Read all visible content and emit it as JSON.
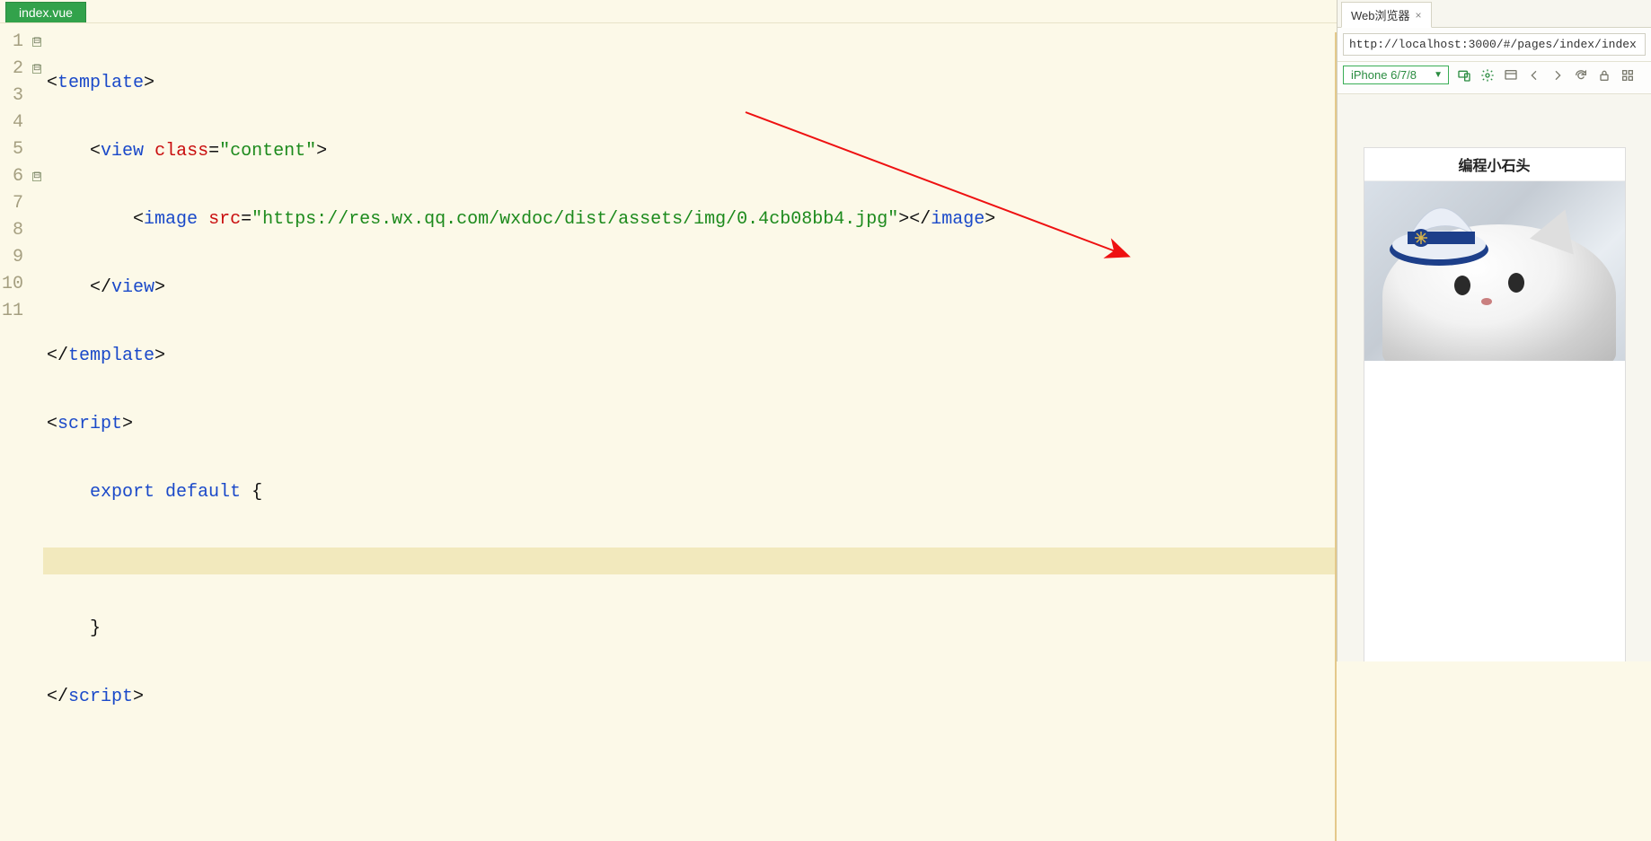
{
  "editor": {
    "tab": {
      "filename": "index.vue"
    },
    "gutter": [
      "1",
      "2",
      "3",
      "4",
      "5",
      "6",
      "7",
      "8",
      "9",
      "10",
      "11"
    ],
    "fold_markers": {
      "1": "⊟",
      "2": "⊟",
      "6": "⊟"
    },
    "highlighted_line": 8,
    "code": {
      "l1": {
        "open": "<",
        "tag": "template",
        "close": ">"
      },
      "l2": {
        "indent": "    ",
        "open": "<",
        "tag": "view",
        "sp": " ",
        "attr": "class",
        "eq": "=",
        "val": "\"content\"",
        "close": ">"
      },
      "l3": {
        "indent": "        ",
        "open": "<",
        "tag": "image",
        "sp": " ",
        "attr": "src",
        "eq": "=",
        "val": "\"https://res.wx.qq.com/wxdoc/dist/assets/img/0.4cb08bb4.jpg\"",
        "close": ">",
        "open2": "</",
        "tag2": "image",
        "close2": ">"
      },
      "l4": {
        "indent": "    ",
        "open": "</",
        "tag": "view",
        "close": ">"
      },
      "l5": {
        "open": "</",
        "tag": "template",
        "close": ">"
      },
      "l6": {
        "open": "<",
        "tag": "script",
        "close": ">"
      },
      "l7": {
        "indent": "    ",
        "kw1": "export",
        "sp1": " ",
        "kw2": "default",
        "sp2": " ",
        "brace": "{"
      },
      "l8": {
        "indent": ""
      },
      "l9": {
        "indent": "    ",
        "brace": "}"
      },
      "l10": {
        "open": "</",
        "tag": "script",
        "close": ">"
      },
      "l11": {
        "indent": ""
      }
    }
  },
  "browser": {
    "panel_tab": "Web浏览器",
    "url": "http://localhost:3000/#/pages/index/index",
    "device": "iPhone 6/7/8",
    "icons": {
      "responsive": "responsive-icon",
      "settings": "gear-icon",
      "devtools": "devtools-icon",
      "back": "back-icon",
      "forward": "forward-icon",
      "refresh": "refresh-icon",
      "lock": "lock-icon",
      "grid": "grid-icon"
    },
    "preview": {
      "title": "编程小石头"
    }
  },
  "annotation": {
    "arrow_from": "code line 3 (image src)",
    "arrow_to": "preview image"
  }
}
